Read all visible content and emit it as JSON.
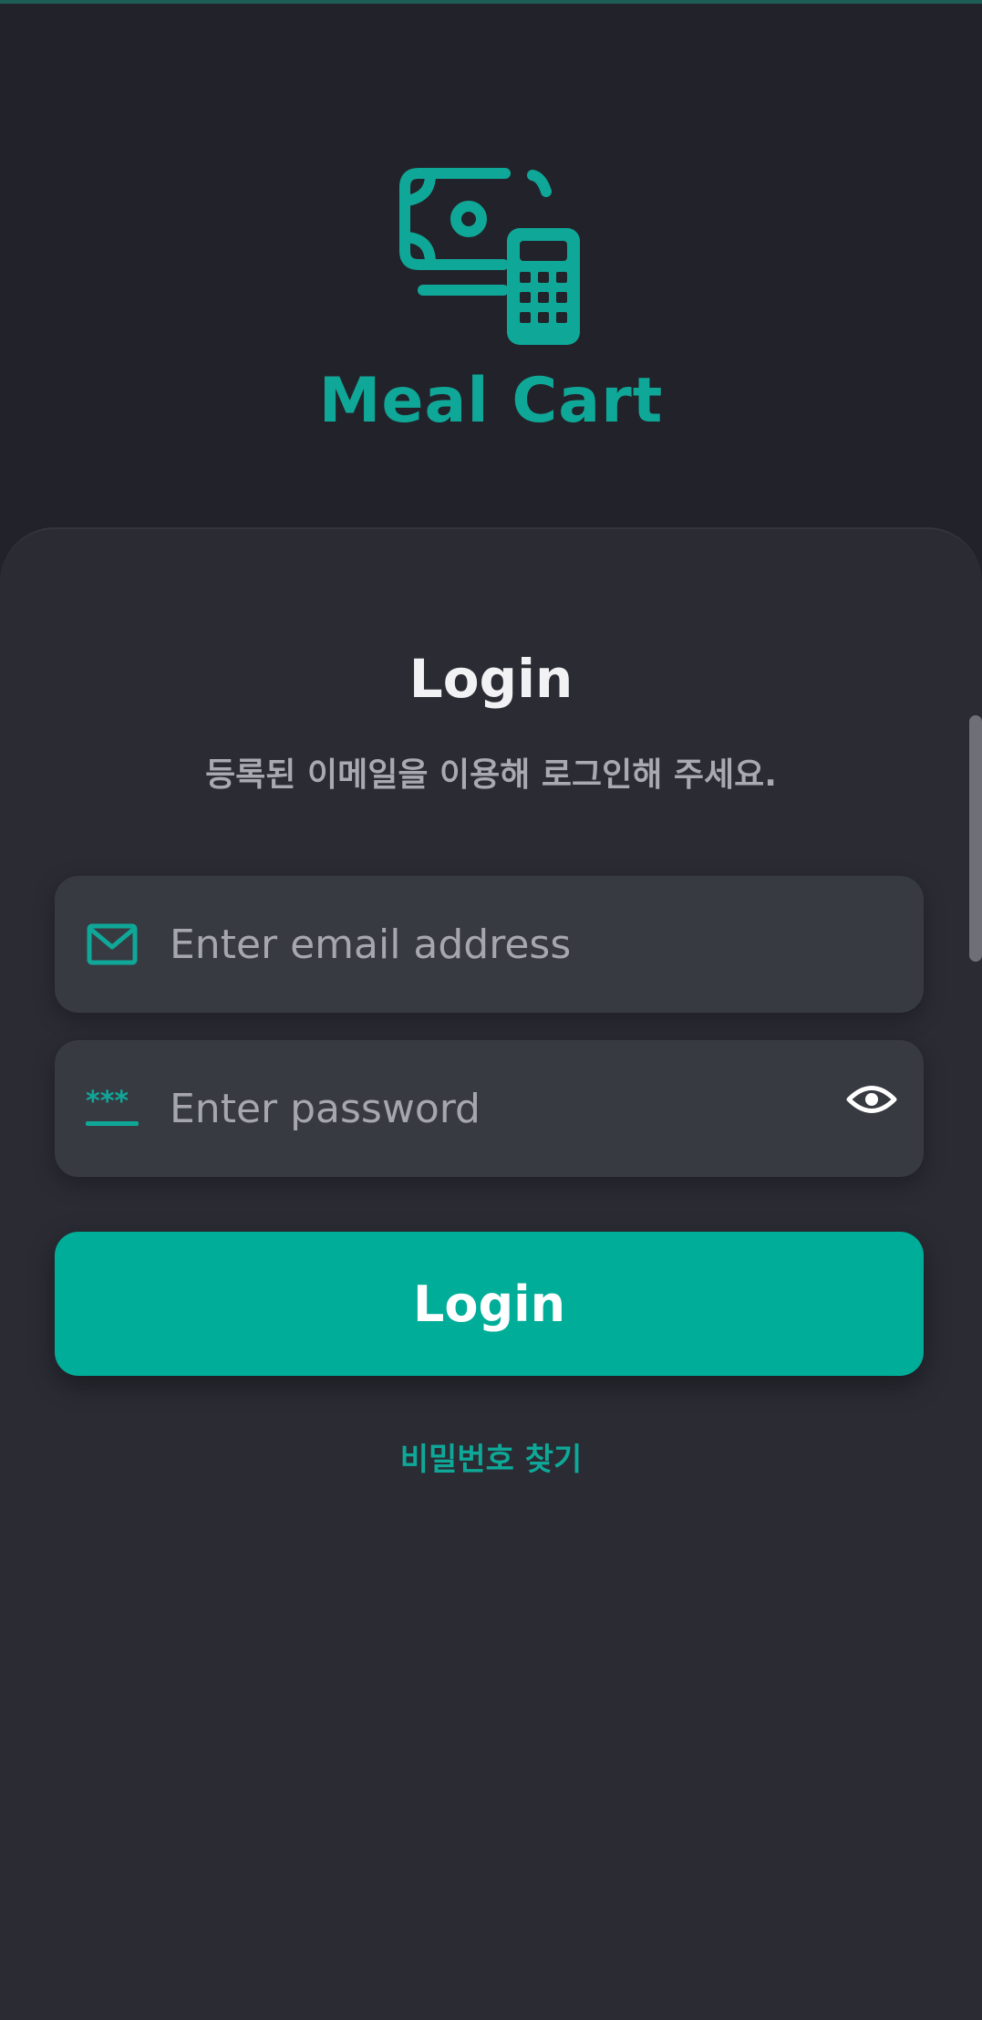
{
  "brand": {
    "app_name": "Meal Cart",
    "logo_icon": "cash-calculator-icon",
    "accent_color": "#0fa898"
  },
  "login": {
    "title": "Login",
    "subtitle": "등록된 이메일을 이용해 로그인해 주세요.",
    "email": {
      "icon": "mail-icon",
      "value": "",
      "placeholder": "Enter email address"
    },
    "password": {
      "icon": "password-dots-icon",
      "value": "",
      "placeholder": "Enter password",
      "toggle_icon": "eye-icon"
    },
    "submit_label": "Login",
    "forgot_label": "비밀번호 찾기"
  }
}
